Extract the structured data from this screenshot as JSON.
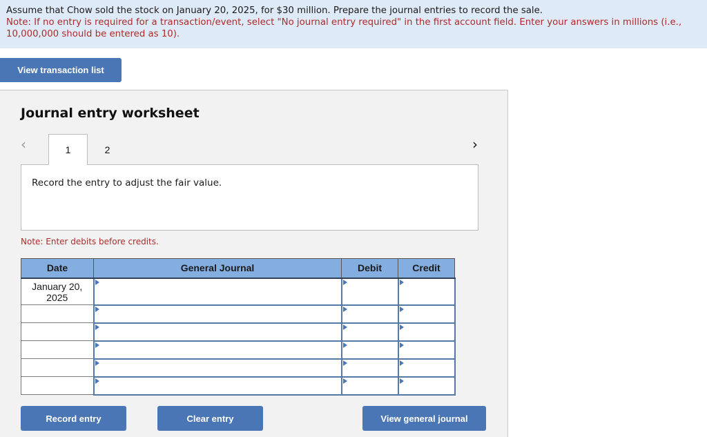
{
  "prompt": {
    "question": "Assume that Chow sold the stock on January 20, 2025, for $30 million. Prepare the journal entries to record the sale.",
    "note": "Note: If no entry is required for a transaction/event, select \"No journal entry required\" in the first account field. Enter your answers in millions (i.e., 10,000,000 should be entered as 10)."
  },
  "buttons": {
    "view_transaction_list": "View transaction list",
    "record_entry": "Record entry",
    "clear_entry": "Clear entry",
    "view_general_journal": "View general journal"
  },
  "worksheet": {
    "title": "Journal entry worksheet",
    "nav_prev_icon": "‹",
    "nav_next_icon": "›",
    "tabs": [
      {
        "label": "1",
        "active": true
      },
      {
        "label": "2",
        "active": false
      }
    ],
    "description": "Record the entry to adjust the fair value.",
    "debit_note": "Note: Enter debits before credits."
  },
  "journal": {
    "headers": {
      "date": "Date",
      "account": "General Journal",
      "debit": "Debit",
      "credit": "Credit"
    },
    "rows": [
      {
        "date": "January 20, 2025",
        "account": "",
        "debit": "",
        "credit": ""
      },
      {
        "date": "",
        "account": "",
        "debit": "",
        "credit": ""
      },
      {
        "date": "",
        "account": "",
        "debit": "",
        "credit": ""
      },
      {
        "date": "",
        "account": "",
        "debit": "",
        "credit": ""
      },
      {
        "date": "",
        "account": "",
        "debit": "",
        "credit": ""
      },
      {
        "date": "",
        "account": "",
        "debit": "",
        "credit": ""
      }
    ]
  },
  "colors": {
    "accent_button": "#4a76b5",
    "header_blue": "#85aee0",
    "note_red": "#b02a2a",
    "prompt_bg": "#deeaf7"
  }
}
